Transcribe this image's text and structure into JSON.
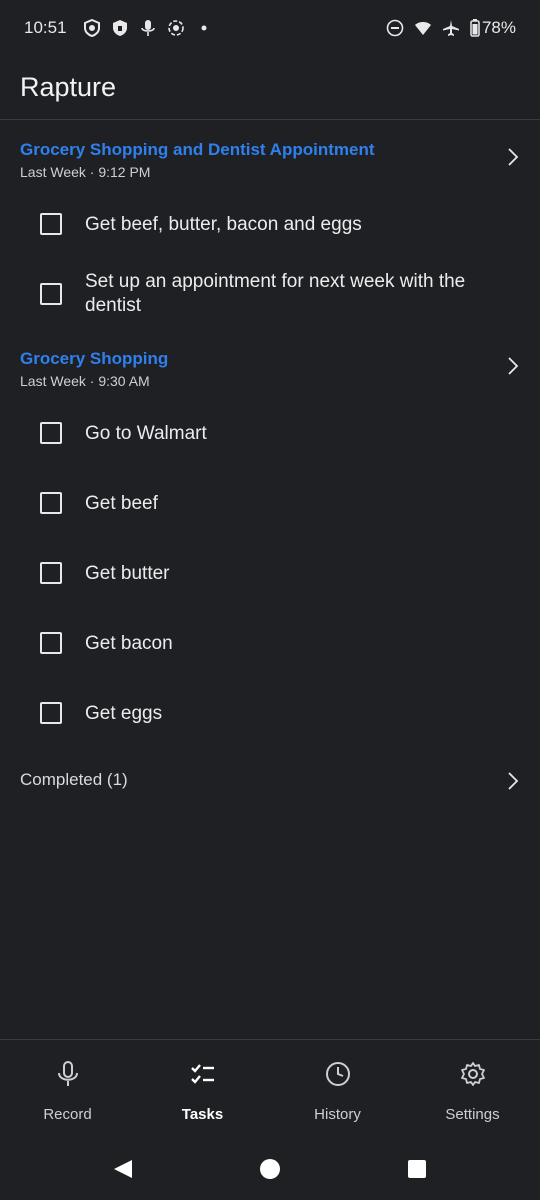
{
  "status_bar": {
    "time": "10:51",
    "battery": "78%",
    "left_icons": [
      "vpn-shield-icon",
      "privacy-shield-icon",
      "microphone-icon",
      "screen-record-icon",
      "notification-dot-icon"
    ],
    "right_icons": [
      "do-not-disturb-icon",
      "wifi-icon",
      "airplane-mode-icon",
      "battery-icon"
    ]
  },
  "app": {
    "title": "Rapture"
  },
  "groups": [
    {
      "title": "Grocery Shopping and Dentist Appointment",
      "meta": "Last Week · 9:12 PM",
      "tasks": [
        "Get beef, butter, bacon and eggs",
        "Set up an appointment for next week with the dentist"
      ]
    },
    {
      "title": "Grocery Shopping",
      "meta": "Last Week · 9:30 AM",
      "tasks": [
        "Go to Walmart",
        "Get beef",
        "Get butter",
        "Get bacon",
        "Get eggs"
      ]
    }
  ],
  "completed": {
    "label": "Completed (1)"
  },
  "bottom_nav": {
    "items": [
      {
        "label": "Record",
        "icon": "microphone-icon"
      },
      {
        "label": "Tasks",
        "icon": "checklist-icon",
        "active": true
      },
      {
        "label": "History",
        "icon": "clock-icon"
      },
      {
        "label": "Settings",
        "icon": "gear-icon"
      }
    ]
  },
  "colors": {
    "accent": "#2f80ed",
    "background": "#1f2023",
    "text": "#ececee"
  }
}
